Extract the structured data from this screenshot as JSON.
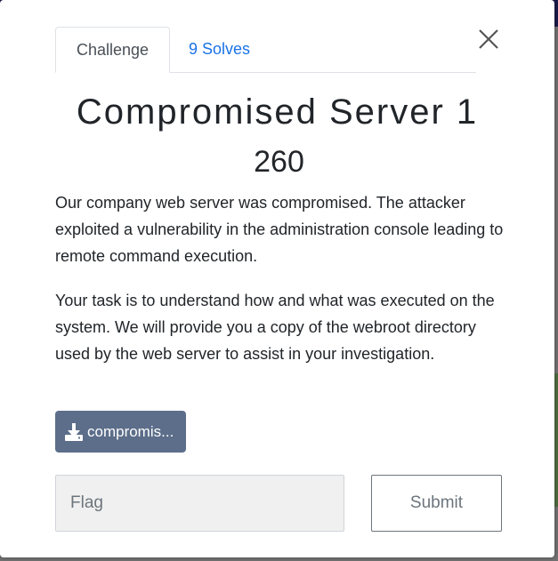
{
  "modal": {
    "tabs": [
      {
        "label": "Challenge",
        "active": true
      },
      {
        "label": "9 Solves",
        "active": false
      }
    ],
    "close_icon": "close-icon",
    "title": "Compromised Server 1",
    "points": "260",
    "description": [
      "Our company web server was compromised. The attacker exploited a vulnerability in the administration console leading to remote command execution.",
      "Your task is to understand how and what was executed on the system. We will provide you a copy of the webroot directory used by the web server to assist in your investigation."
    ],
    "download": {
      "label": "compromis...",
      "icon": "download-icon"
    },
    "flag_input": {
      "placeholder": "Flag",
      "value": ""
    },
    "submit_label": "Submit"
  },
  "colors": {
    "tab_link": "#1a73e8",
    "download_button": "#5c6e8a",
    "input_background": "#f0f0f0",
    "submit_border": "#6c757d"
  }
}
